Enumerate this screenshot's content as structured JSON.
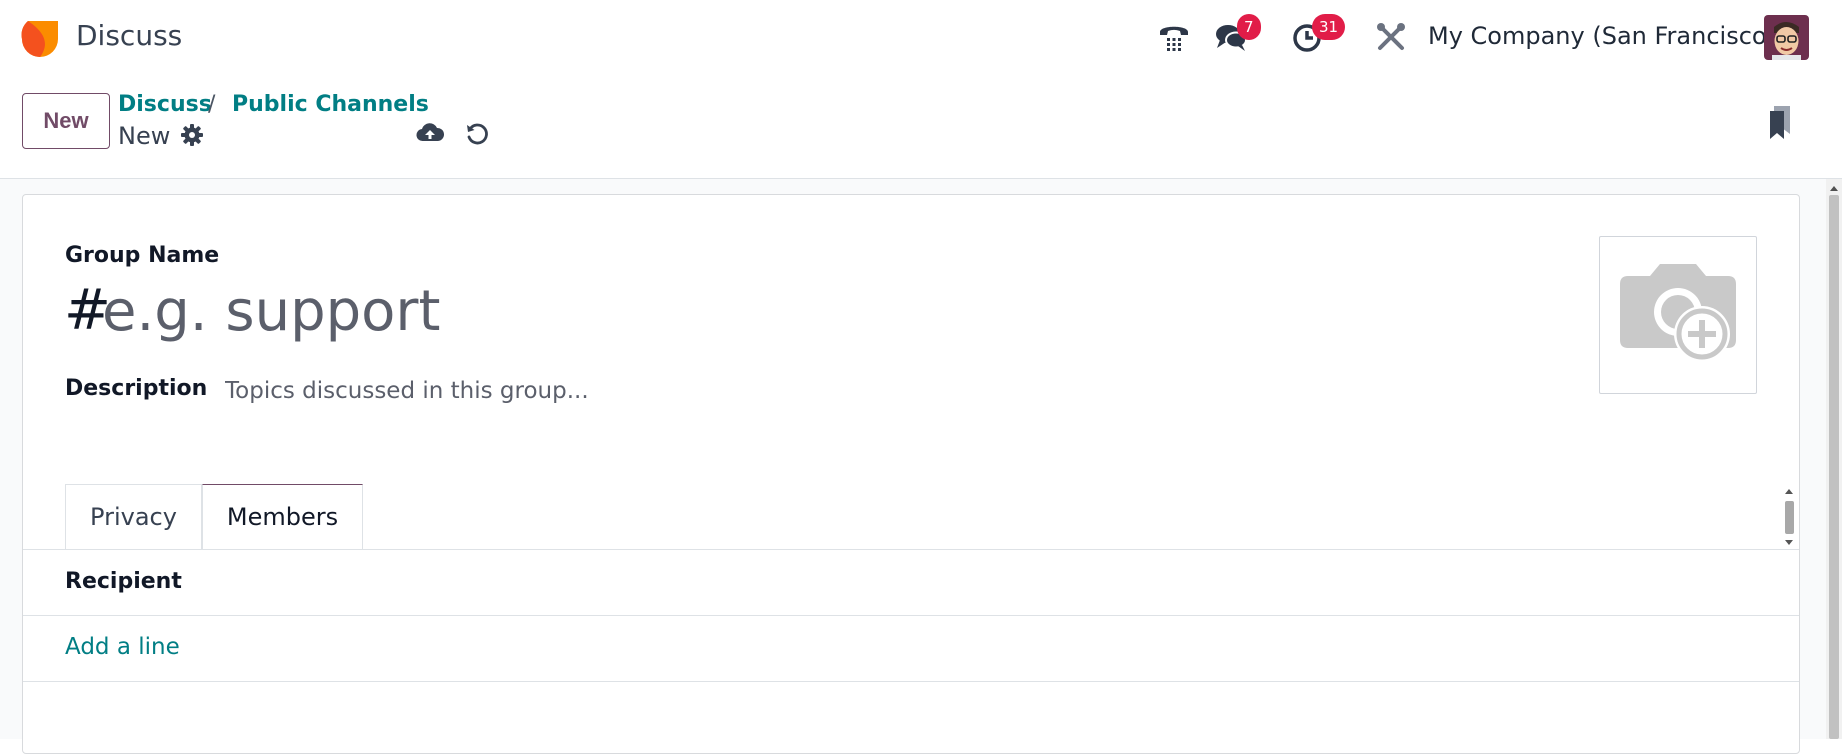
{
  "navbar": {
    "app_title": "Discuss",
    "messages_badge": "7",
    "activities_badge": "31",
    "company": "My Company (San Francisco)"
  },
  "control_panel": {
    "new_button": "New",
    "breadcrumb_root": "Discuss",
    "breadcrumb_sep": "/",
    "breadcrumb_current": "Public Channels",
    "record_name": "New"
  },
  "form": {
    "group_name_label": "Group Name",
    "name_prefix": "#",
    "name_placeholder": "e.g. support",
    "description_label": "Description",
    "description_placeholder": "Topics discussed in this group..."
  },
  "tabs": [
    {
      "label": "Privacy",
      "active": false
    },
    {
      "label": "Members",
      "active": true
    }
  ],
  "members": {
    "column_header": "Recipient",
    "add_line": "Add a line"
  },
  "colors": {
    "brand": "#714b67",
    "link": "#017e84",
    "badge": "#e11d48"
  }
}
